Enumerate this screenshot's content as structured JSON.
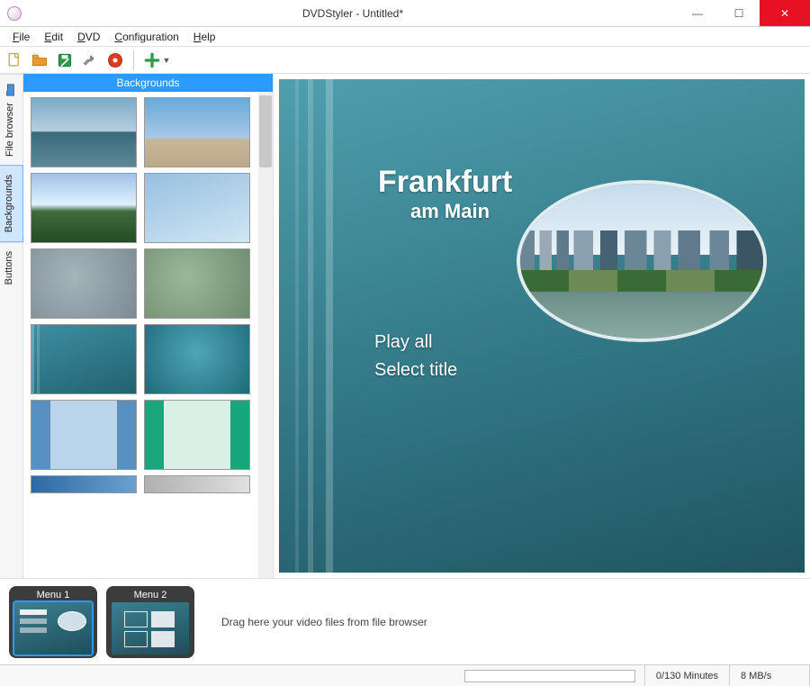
{
  "window": {
    "title": "DVDStyler - Untitled*"
  },
  "menu": {
    "file": "File",
    "edit": "Edit",
    "dvd": "DVD",
    "config": "Configuration",
    "help": "Help"
  },
  "vtabs": {
    "file_browser": "File browser",
    "backgrounds": "Backgrounds",
    "buttons": "Buttons"
  },
  "bg_panel": {
    "header": "Backgrounds"
  },
  "preview": {
    "title1": "Frankfurt",
    "title2": "am Main",
    "play_all": "Play all",
    "select_title": "Select title"
  },
  "timeline": {
    "menu1": "Menu 1",
    "menu2": "Menu 2",
    "drag_hint": "Drag here your video files from file browser"
  },
  "status": {
    "minutes": "0/130 Minutes",
    "bitrate": "8 MB/s"
  }
}
